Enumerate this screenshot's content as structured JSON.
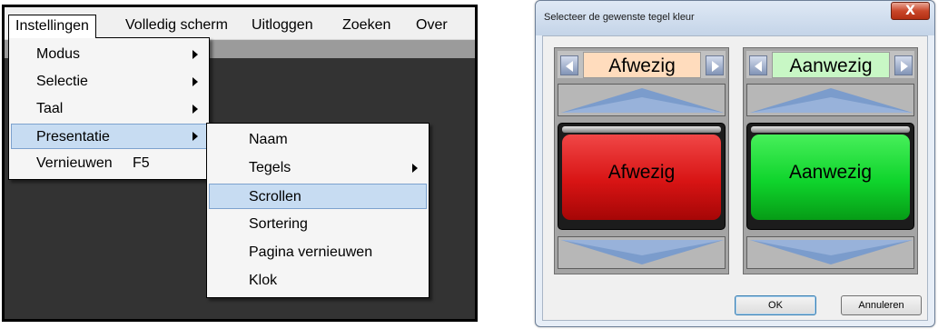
{
  "menubar": {
    "items": [
      "Instellingen",
      "Volledig scherm",
      "Uitloggen",
      "Zoeken",
      "Over"
    ]
  },
  "instellingen_menu": [
    {
      "label": "Modus",
      "submenu": true
    },
    {
      "label": "Selectie",
      "submenu": true
    },
    {
      "label": "Taal",
      "submenu": true
    },
    {
      "label": "Presentatie",
      "submenu": true,
      "highlighted": true
    },
    {
      "label": "Vernieuwen",
      "shortcut": "F5"
    }
  ],
  "presentatie_menu": [
    {
      "label": "Naam"
    },
    {
      "label": "Tegels",
      "submenu": true
    },
    {
      "label": "Scrollen",
      "highlighted": true
    },
    {
      "label": "Sortering"
    },
    {
      "label": "Pagina vernieuwen"
    },
    {
      "label": "Klok"
    }
  ],
  "dialog": {
    "title": "Selecteer de gewenste tegel kleur",
    "close_glyph": "X",
    "panels": [
      {
        "header_label": "Afwezig",
        "tile_label": "Afwezig",
        "color_name": "red"
      },
      {
        "header_label": "Aanwezig",
        "tile_label": "Aanwezig",
        "color_name": "green"
      }
    ],
    "ok_label": "OK",
    "cancel_label": "Annuleren"
  },
  "colors": {
    "highlight": "#c7dcf2",
    "absent_chip": "#ffdcbd",
    "present_chip": "#c8f7c5",
    "absent_tile": "#d81414",
    "present_tile": "#0fd42c"
  },
  "icons": [
    "chevron-right-icon",
    "chevron-left-icon",
    "arrow-up-icon",
    "arrow-down-icon",
    "close-icon"
  ]
}
